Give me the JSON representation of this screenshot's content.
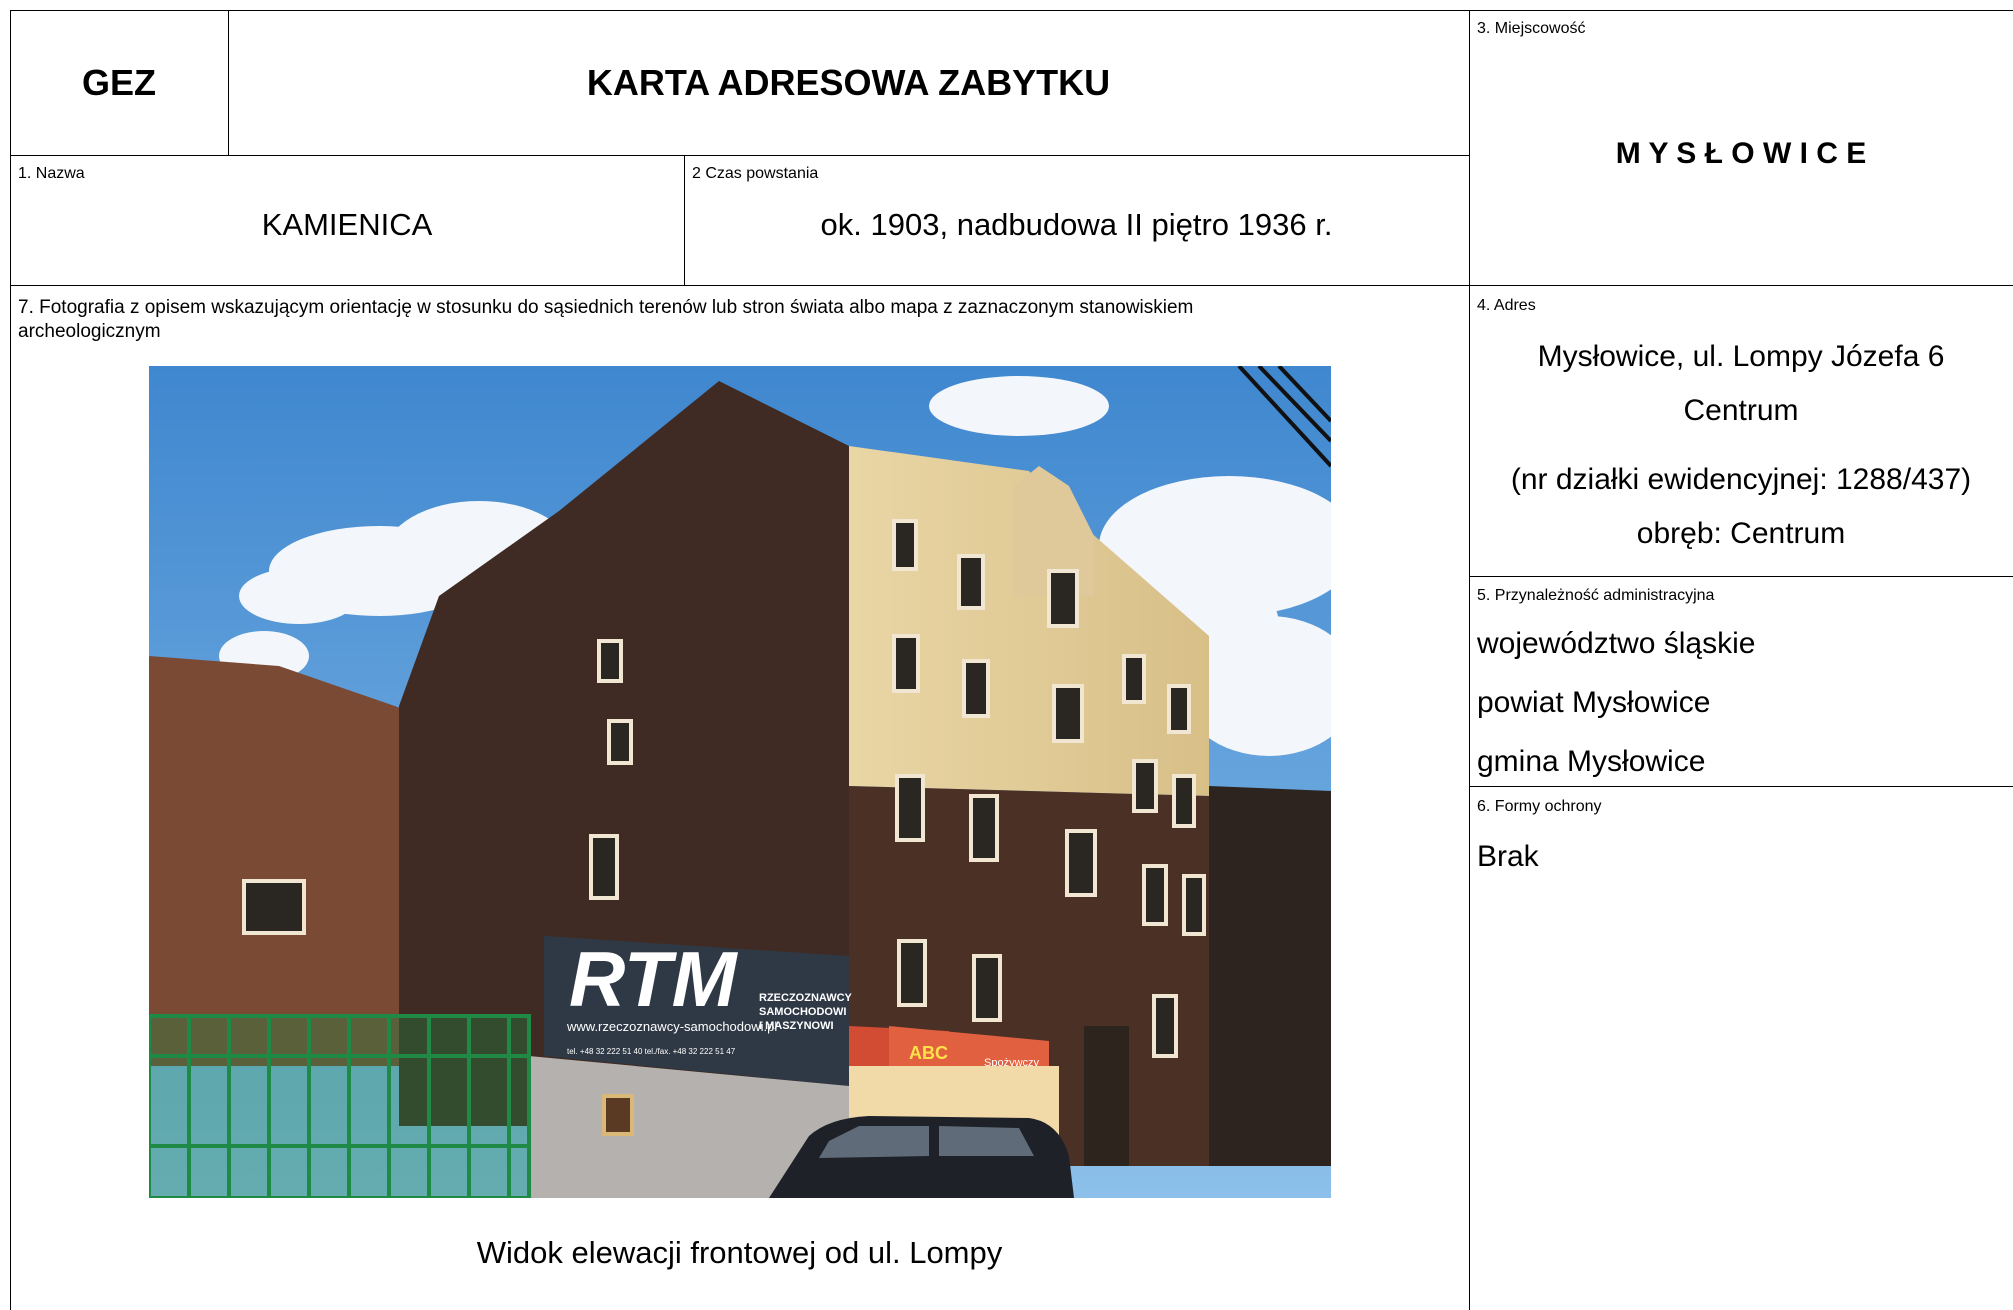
{
  "header": {
    "code": "GEZ",
    "title": "KARTA ADRESOWA ZABYTKU"
  },
  "fields": {
    "name": {
      "label": "1. Nazwa",
      "value": "KAMIENICA"
    },
    "date": {
      "label": "2 Czas powstania",
      "value": "ok. 1903, nadbudowa II piętro 1936 r."
    },
    "locality": {
      "label": "3. Miejscowość",
      "value": "M Y S Ł O W I C E"
    },
    "address": {
      "label": "4. Adres",
      "line1": "Mysłowice, ul. Lompy Józefa 6",
      "line2": "Centrum",
      "line3": "(nr działki ewidencyjnej: 1288/437)",
      "line4": "obręb: Centrum"
    },
    "admin": {
      "label": "5. Przynależność administracyjna",
      "voivodeship": "województwo śląskie",
      "county": "powiat Mysłowice",
      "commune": "gmina Mysłowice"
    },
    "protection": {
      "label": "6. Formy ochrony",
      "value": "Brak"
    },
    "photo": {
      "label_line1": "7. Fotografia z opisem wskazującym orientację w stosunku do sąsiednich terenów lub stron świata albo mapa z zaznaczonym stanowiskiem",
      "label_line2": "archeologicznym",
      "caption": "Widok elewacji frontowej od ul. Lompy"
    }
  },
  "photo_signage": {
    "brand": "RTM",
    "line1": "RZECZOZNAWCY",
    "line2": "SAMOCHODOWI",
    "line3": "I MASZYNOWI",
    "website": "www.rzeczoznawcy-samochodowi.pl",
    "phones": "tel. +48 32 222 51 40   tel./fax. +48 32 222 51 47",
    "shop_sign": "ABC",
    "shop_sign2": "Spożywczy"
  },
  "colors": {
    "sky": "#4f93d4",
    "brick": "#4a3025",
    "plaster": "#e4cf9a",
    "fence": "#1e8a45",
    "sign_blue": "#2f3946"
  }
}
